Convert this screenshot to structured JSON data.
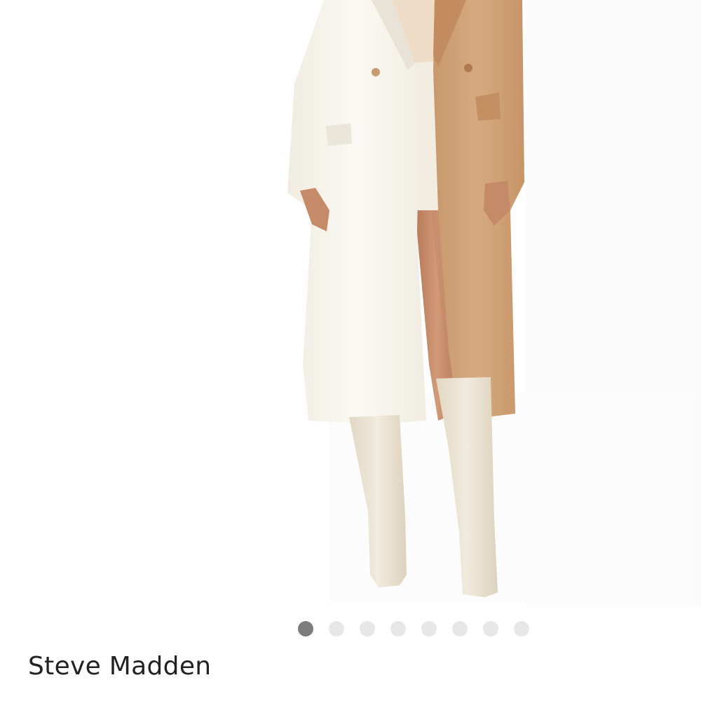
{
  "product": {
    "brand": "Steve Madden",
    "title": ""
  },
  "gallery": {
    "dots": [
      {
        "active": true
      },
      {
        "active": false
      },
      {
        "active": false
      },
      {
        "active": false
      },
      {
        "active": false
      },
      {
        "active": false
      },
      {
        "active": false
      },
      {
        "active": false
      }
    ]
  },
  "colors": {
    "coat_white": "#f8f5ee",
    "coat_camel": "#d4a67c",
    "boots": "#ece4d2",
    "skin": "#c98c69",
    "dot_active": "#7d7d7d",
    "dot_inactive": "#e7e7e7"
  }
}
